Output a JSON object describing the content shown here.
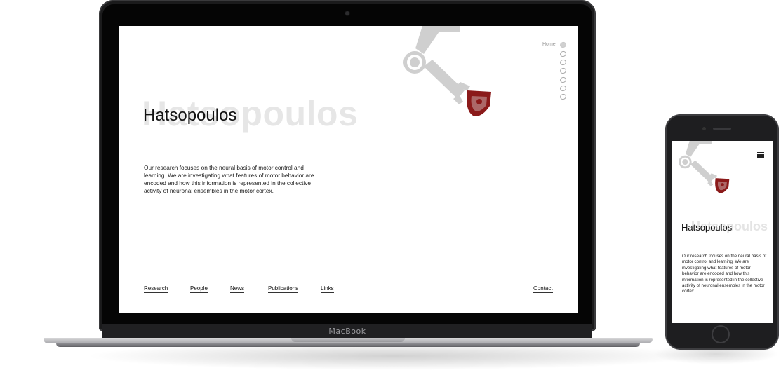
{
  "laptop": {
    "brand": "MacBook"
  },
  "site": {
    "title": "Hatsopoulos",
    "ghost_title": "Hatsopoulos",
    "description": "Our research focuses on the neural basis of motor control and learning. We are investigating what features of motor behavior are encoded and how this information is represented in the collective activity of neuronal ensembles in the motor cortex.",
    "side_nav": {
      "active_label": "Home",
      "dot_count": 7
    },
    "nav": {
      "research": "Research",
      "people": "People",
      "news": "News",
      "publications": "Publications",
      "links": "Links",
      "contact": "Contact"
    },
    "colors": {
      "crest": "#8b1a1a",
      "arm": "#cfcfcf",
      "ghost_text": "#e6e6e6"
    }
  },
  "mobile": {
    "title": "Hatsopoulos",
    "ghost_title": "Hatsopoulos",
    "description": "Our research focuses on the neural basis of motor control and learning. We are investigating what features of motor behavior are encoded and how this information is represented in the collective activity of neuronal ensembles in the motor cortex.",
    "menu_icon": "hamburger-icon"
  }
}
